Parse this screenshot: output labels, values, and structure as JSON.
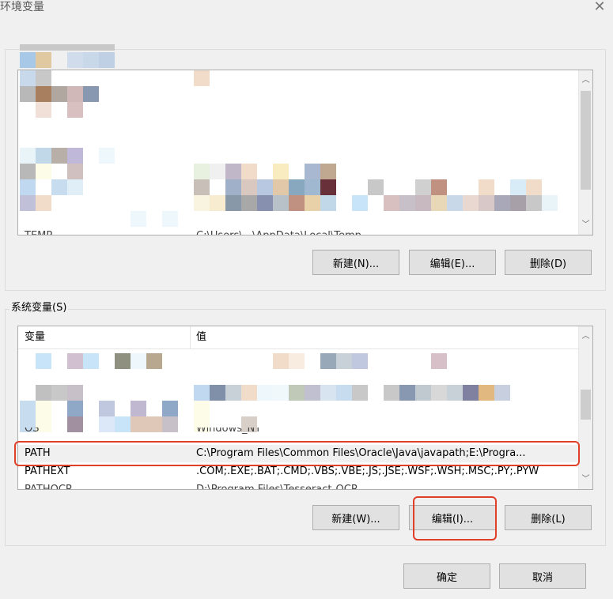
{
  "window": {
    "title": "环境变量"
  },
  "user_section": {
    "partial_row": {
      "name": "TEMP",
      "value": "C:\\Users\\...\\AppData\\Local\\Temp"
    },
    "buttons": {
      "new": "新建(N)...",
      "edit": "编辑(E)...",
      "delete": "删除(D)"
    }
  },
  "system_section": {
    "legend": "系统变量(S)",
    "columns": {
      "name": "变量",
      "value": "值"
    },
    "rows": [
      {
        "name": "OS",
        "value": "Windows_NT"
      },
      {
        "name": "PATH",
        "value": "C:\\Program Files\\Common Files\\Oracle\\Java\\javapath;E:\\Progra..."
      },
      {
        "name": "PATHEXT",
        "value": ".COM;.EXE;.BAT;.CMD;.VBS;.VBE;.JS;.JSE;.WSF;.WSH;.MSC;.PY;.PYW"
      },
      {
        "name": "PATHOCR",
        "value": "D:\\Program Files\\Tesseract-OCR"
      }
    ],
    "buttons": {
      "new": "新建(W)...",
      "edit": "编辑(I)...",
      "delete": "删除(L)"
    }
  },
  "footer": {
    "ok": "确定",
    "cancel": "取消"
  },
  "colors": {
    "highlight": "#e0402a",
    "selected_row": "#f0f0f0"
  },
  "icons": {
    "close": "close-icon",
    "scroll_up": "chevron-up-icon",
    "scroll_down": "chevron-down-icon"
  }
}
